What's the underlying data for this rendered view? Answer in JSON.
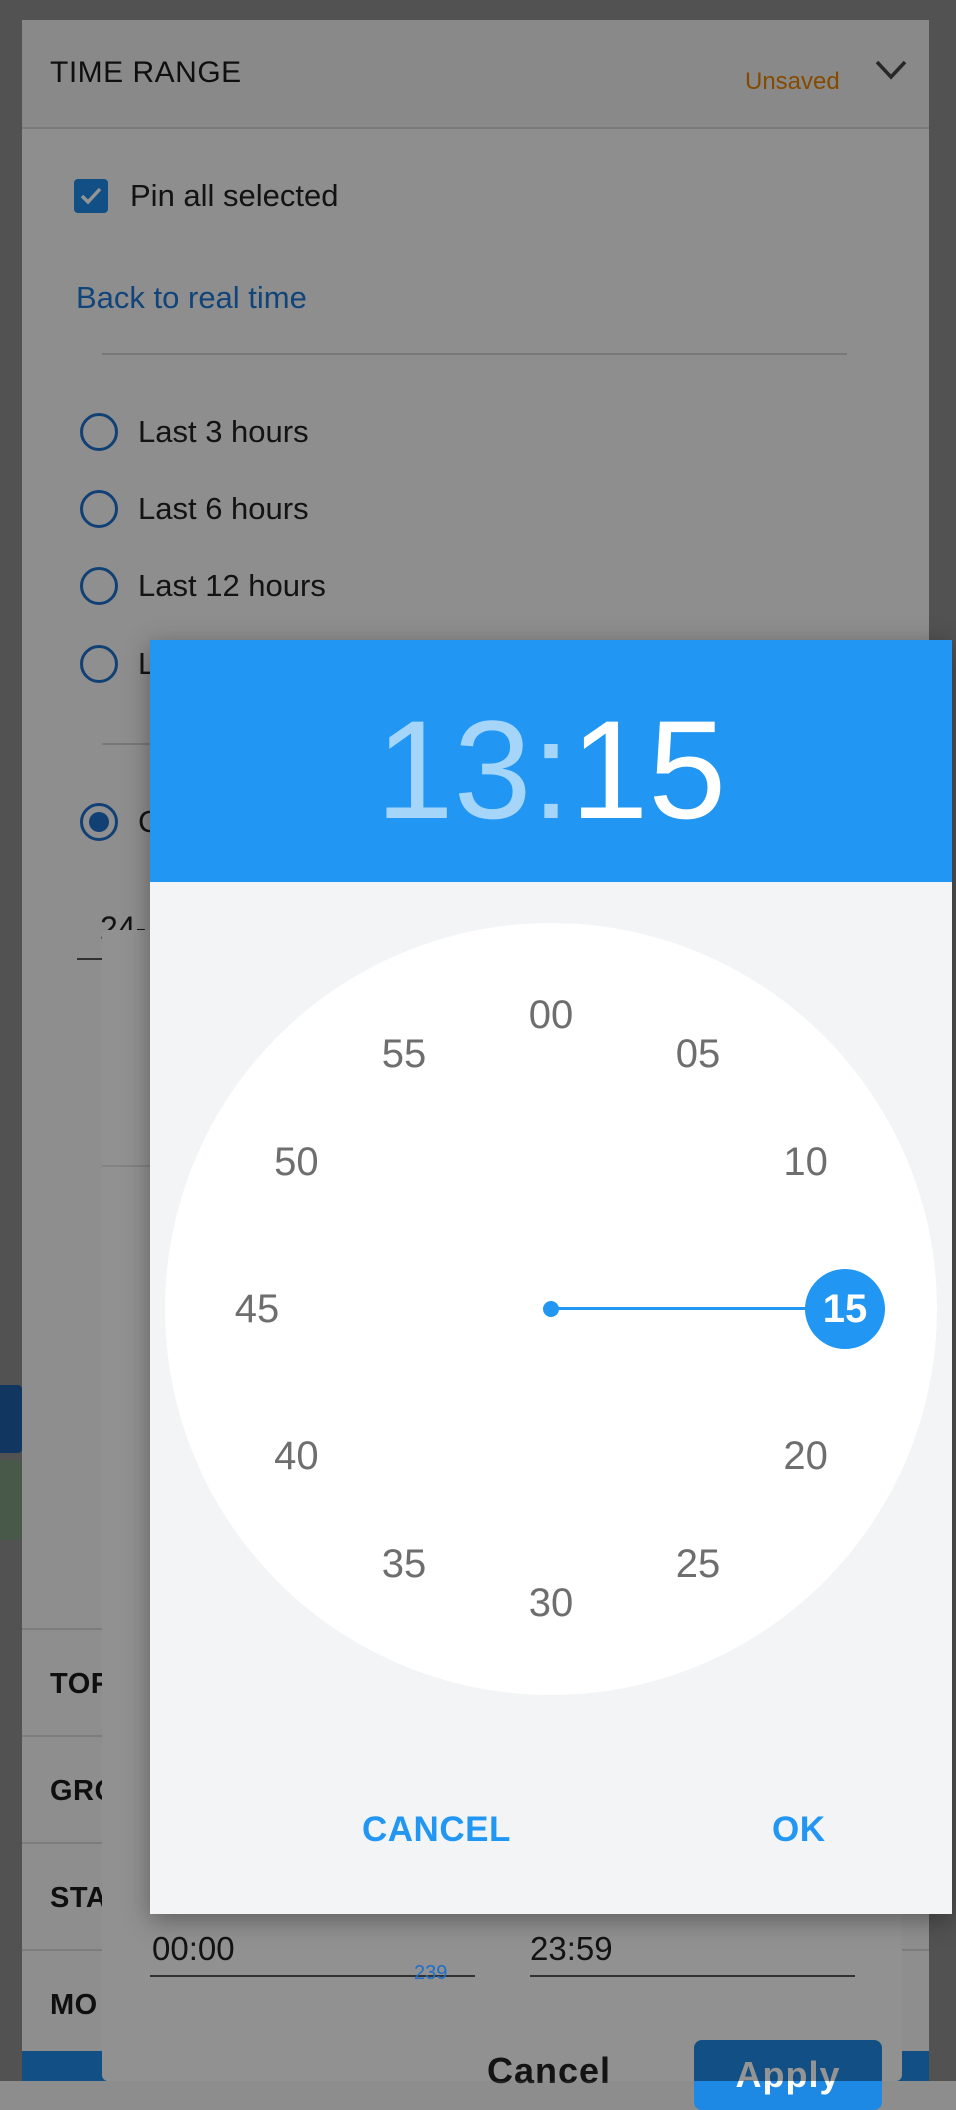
{
  "panel": {
    "title": "TIME RANGE",
    "status": "Unsaved",
    "pin_label": "Pin all selected",
    "back_link": "Back to real time",
    "radio_options": [
      "Last 3 hours",
      "Last 6 hours",
      "Last 12 hours",
      "L",
      "C"
    ],
    "selected_option_index": 4,
    "date_value": "24-",
    "sections": [
      "TOF",
      "GRO",
      "STA",
      "MO"
    ]
  },
  "range_dialog": {
    "start_time": "00:00",
    "end_time": "23:59",
    "cancel_label": "Cancel",
    "apply_label": "Apply",
    "page_number": "239"
  },
  "time_picker": {
    "hour": "13",
    "separator": ":",
    "minute": "15",
    "mode": "minutes",
    "dial_values": [
      "00",
      "05",
      "10",
      "15",
      "20",
      "25",
      "30",
      "35",
      "40",
      "45",
      "50",
      "55"
    ],
    "selected_value": "15",
    "cancel_label": "CANCEL",
    "ok_label": "OK",
    "accent_color": "#2196f3"
  }
}
